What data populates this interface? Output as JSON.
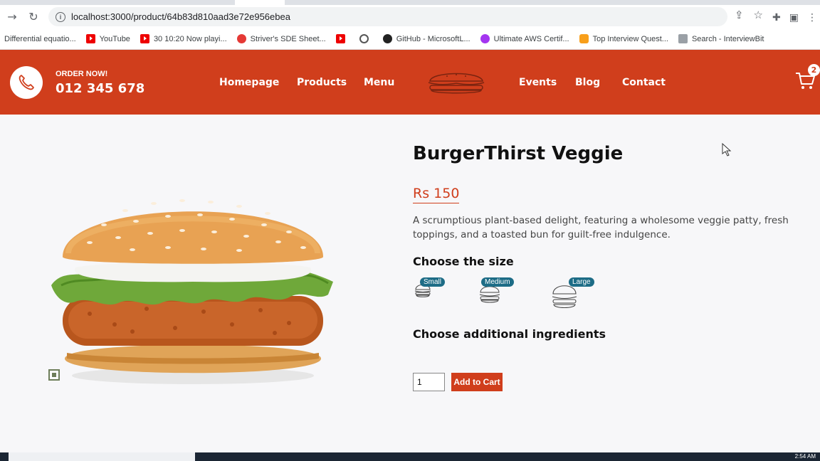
{
  "browser": {
    "url": "localhost:3000/product/64b83d810aad3e72e956ebea",
    "bookmarks": [
      {
        "label": "Differential equatio...",
        "icon": "none"
      },
      {
        "label": "YouTube",
        "icon": "youtube-icon"
      },
      {
        "label": "30 10:20 Now playi...",
        "icon": "youtube-icon"
      },
      {
        "label": "Striver's SDE Sheet...",
        "icon": "site-icon"
      },
      {
        "label": "",
        "icon": "youtube-icon"
      },
      {
        "label": "",
        "icon": "globe-icon"
      },
      {
        "label": "GitHub - MicrosoftL...",
        "icon": "github-icon"
      },
      {
        "label": "Ultimate AWS Certif...",
        "icon": "udemy-icon"
      },
      {
        "label": "Top Interview Quest...",
        "icon": "leetcode-icon"
      },
      {
        "label": "Search - InterviewBit",
        "icon": "interviewbit-icon"
      }
    ]
  },
  "header": {
    "order_label": "ORDER NOW!",
    "phone": "012 345 678",
    "nav": [
      "Homepage",
      "Products",
      "Menu",
      "Events",
      "Blog",
      "Contact"
    ],
    "cart_count": "2",
    "brand_color": "#d03e1c"
  },
  "product": {
    "name": "BurgerThirst Veggie",
    "price": "Rs 150",
    "description": "A scrumptious plant-based delight, featuring a wholesome veggie patty, fresh toppings, and a toasted bun for guilt-free indulgence.",
    "size_heading": "Choose the size",
    "sizes": [
      "Small",
      "Medium",
      "Large"
    ],
    "ingredients_heading": "Choose additional ingredients",
    "quantity": "1",
    "add_to_cart": "Add to Cart"
  },
  "taskbar": {
    "clock": "2:54 AM"
  }
}
